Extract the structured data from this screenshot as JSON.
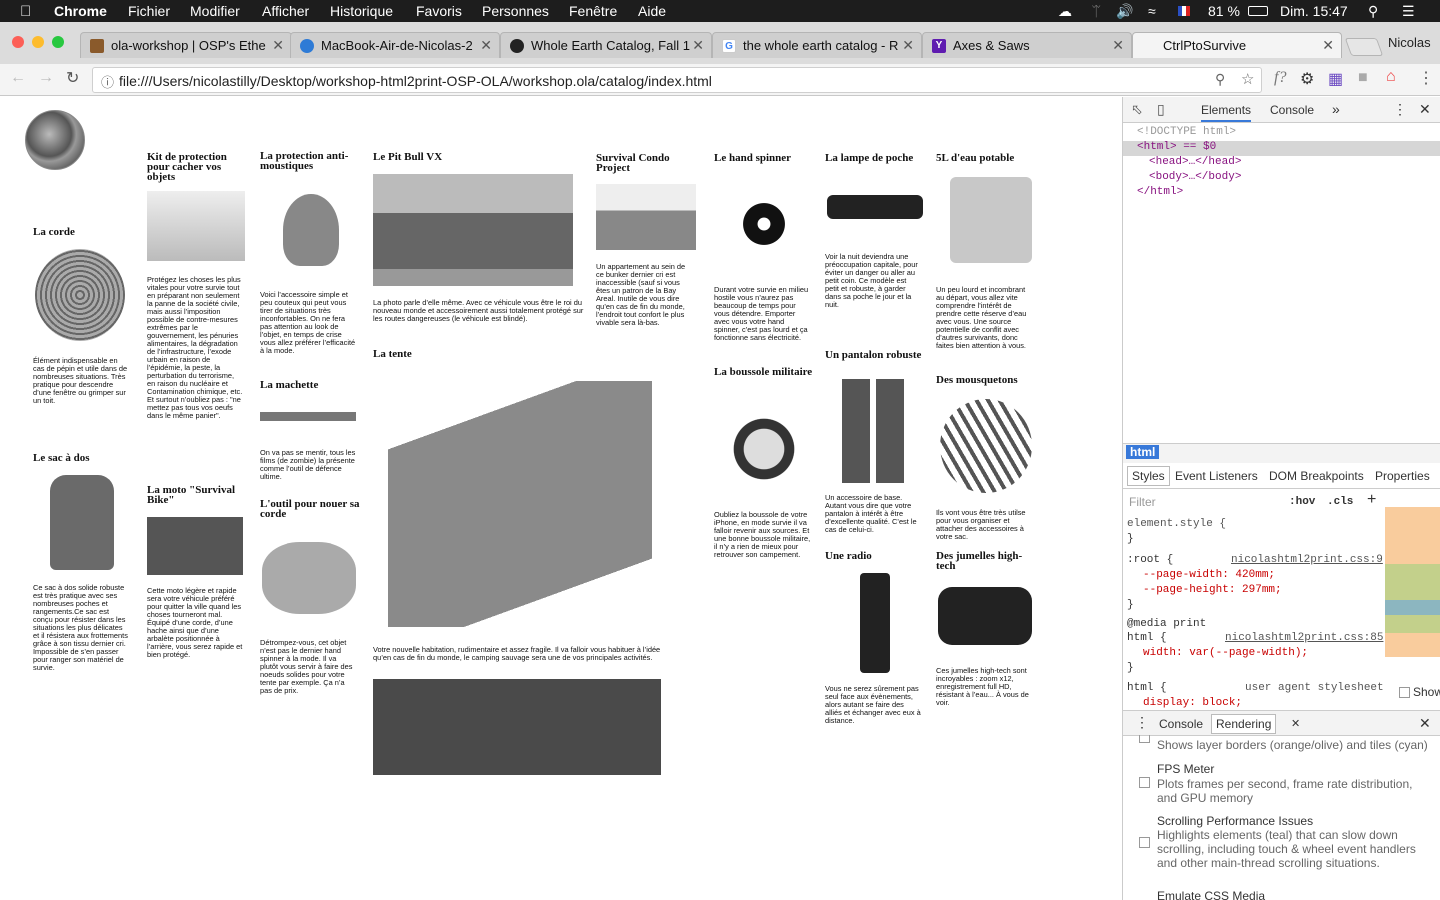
{
  "menubar": {
    "app": "Chrome",
    "items": [
      "Fichier",
      "Modifier",
      "Afficher",
      "Historique",
      "Favoris",
      "Personnes",
      "Fenêtre",
      "Aide"
    ],
    "battery": "81 %",
    "clock": "Dim. 15:47"
  },
  "tabs": [
    {
      "title": "ola-workshop | OSP's Ethe"
    },
    {
      "title": "MacBook-Air-de-Nicolas-2"
    },
    {
      "title": "Whole Earth Catalog, Fall 1"
    },
    {
      "title": "the whole earth catalog - R"
    },
    {
      "title": "Axes & Saws"
    },
    {
      "title": "CtrlPtoSurvive"
    }
  ],
  "profile": "Nicolas",
  "url": "file:///Users/nicolastilly/Desktop/workshop-html2print-OSP-OLA/workshop.ola/catalog/index.html",
  "items": {
    "corde": {
      "h": "La corde",
      "t": "Élément indispensable en cas de pépin et utile dans de nombreuses situations. Très pratique pour descendre d’une fenêtre ou grimper sur un toit."
    },
    "sac": {
      "h": "Le sac à dos",
      "t": "Ce sac à dos solide robuste est très pratique avec ses nombreuses poches et rangements.Ce sac est conçu pour résister dans les situations les plus délicates et il résistera aux frottements grâce à son tissu dernier cri. Impossible de s’en passer pour ranger son matériel de survie."
    },
    "kit": {
      "h": "Kit de protection pour cacher vos objets",
      "t": "Protégez les choses les plus vitales pour votre survie tout en préparant non seulement la panne de la société civile, mais aussi l’imposition possible de contre-mesures extrêmes par le gouvernement, les pénuries alimentaires, la dégradation de l’infrastructure, l’exode urbain en raison de l’épidémie, la peste, la perturbation du terrorisme, en raison du nucléaire et Contamination chimique, etc. Et surtout n’oubliez pas : \"ne mettez pas tous vos oeufs dans le même panier\"."
    },
    "moto": {
      "h": "La moto \"Survival Bike\"",
      "t": "Cette moto légère et rapide sera votre véhicule préféré pour quitter la ville quand les choses tourneront mal. Équipé d’une corde, d’une hache ainsi que d’une arbalète positionnée à l’arrière, vous serez rapide et bien protégé."
    },
    "mous": {
      "h": "La protection anti-moustiques",
      "t": "Voici l’accessoire simple et peu couteux qui peut vous tirer de situations très inconfortables. On ne fera pas attention au look de l’objet, en temps de crise vous allez préférer l’efficacité à la mode."
    },
    "mach": {
      "h": "La machette",
      "t": "On va pas se mentir, tous les films (de zombie) la présente comme l’outil de défence ultime."
    },
    "outil": {
      "h": "L'outil pour nouer sa corde",
      "t": "Détrompez-vous, cet objet n’est pas le dernier hand spinner à la mode. Il va plutôt vous servir à faire des noeuds solides pour votre tente par exemple. Ça n’a pas de prix."
    },
    "pit": {
      "h": "Le Pit Bull VX",
      "t": "La photo parle d’elle même. Avec ce véhicule vous être le roi du nouveau monde et accessoirement aussi totalement protégé sur les routes dangereuses (le véhicule est blindé)."
    },
    "tente": {
      "h": "La tente",
      "t": "Votre nouvelle habitation, rudimentaire et assez fragile. Il va falloir vous habituer à l’idée qu’en cas de fin du monde, le camping sauvage sera une de vos principales activités."
    },
    "condo": {
      "h": "Survival Condo Project",
      "t": "Un appartement au sein de ce bunker dernier cri est inaccessible (sauf si vous êtes un patron de la Bay Areal. Inutile de vous dire qu’en cas de fin du monde, l’endroit tout confort le plus vivable sera là-bas."
    },
    "spin": {
      "h": "Le hand spinner",
      "t": "Durant votre survie en milieu hostile vous n’aurez pas beaucoup de temps pour vous détendre. Emporter avec vous votre hand spinner, c’est pas lourd et ça fonctionne sans électricité."
    },
    "bous": {
      "h": "La boussole militaire",
      "t": "Oubliez la boussole de votre iPhone, en mode survie il va falloir revenir aux sources. Et une bonne boussole militaire, il n’y a rien de mieux pour retrouver son campement."
    },
    "lamp": {
      "h": "La lampe de poche",
      "t": "Voir la nuit deviendra une préoccupation capitale, pour éviter un danger ou aller au petit coin. Ce modèle est petit et robuste, à garder dans sa poche le jour et la nuit."
    },
    "pant": {
      "h": "Un pantalon robuste",
      "t": "Un accessoire de base. Autant vous dire que votre pantalon à intérêt à être d’excellente qualité. C’est le cas de celui-ci."
    },
    "radio": {
      "h": "Une radio",
      "t": "Vous ne serez sûrement pas seul face aux évènements, alors autant se faire des alliés et échanger avec eux à distance."
    },
    "eau": {
      "h": "5L d'eau potable",
      "t": "Un peu lourd et incombrant au départ, vous allez vite comprendre l’intérêt de prendre cette réserve d’eau avec vous. Une source potentielle de conflit avec d’autres survivants, donc faites bien attention à vous."
    },
    "mousq": {
      "h": "Des mousquetons",
      "t": "Ils vont vous être très utilse pour vous organiser et attacher des accessoires à votre sac."
    },
    "jum": {
      "h": "Des jumelles high-tech",
      "t": "Ces jumelles high-tech sont incroyables : zoom x12, enregistrement full HD, résistant à l’eau... À vous de voir."
    }
  },
  "devtools": {
    "tabs": [
      "Elements",
      "Console"
    ],
    "breadcrumb": "html",
    "subtabs": [
      "Styles",
      "Event Listeners",
      "DOM Breakpoints",
      "Properties"
    ],
    "filter": "Filter",
    "hov": ":hov",
    "cls": ".cls",
    "drawer": [
      "Console",
      "Rendering"
    ],
    "dom": [
      "<!DOCTYPE html>",
      "<html> == $0",
      "<head>…</head>",
      "<body>…</body>",
      "</html>"
    ],
    "styles": [
      "element.style {",
      "}",
      ":root {",
      "--page-width: 420mm;",
      "--page-height: 297mm;",
      "}",
      "@media print",
      "html {",
      "width: var(--page-width);",
      "}",
      "html {",
      "display: block;"
    ],
    "src1": "nicolashtml2print.css:9",
    "src2": "nicolashtml2print.css:85",
    "ua": "user agent stylesheet",
    "show": "Show",
    "rendering": [
      {
        "t": "",
        "d": "Shows layer borders (orange/olive) and tiles (cyan)"
      },
      {
        "t": "FPS Meter",
        "d": "Plots frames per second, frame rate distribution, and GPU memory"
      },
      {
        "t": "Scrolling Performance Issues",
        "d": "Highlights elements (teal) that can slow down scrolling, including touch & wheel event handlers and other main-thread scrolling situations."
      },
      {
        "t": "Emulate CSS Media",
        "d": ""
      }
    ]
  }
}
